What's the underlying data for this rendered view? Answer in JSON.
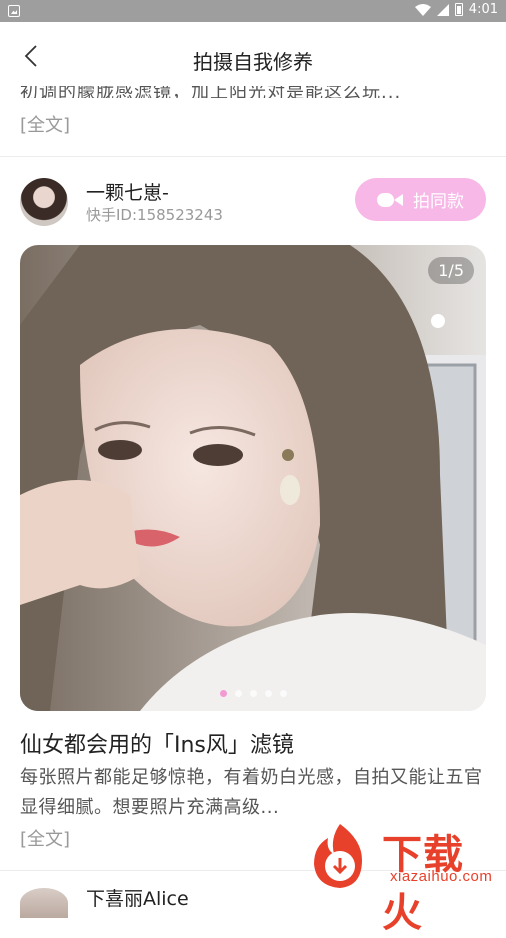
{
  "status_bar": {
    "time": "4:01"
  },
  "header": {
    "title": "拍摄自我修养",
    "back_icon": "chevron-left-icon"
  },
  "previous_post": {
    "desc_tail": "初调的朦胧感滤镜，加上阳光对是能这么玩...",
    "full_text_label": "[全文]"
  },
  "post": {
    "author": {
      "name": "一颗七崽-",
      "id_label": "快手ID:158523243"
    },
    "shoot_same_button": {
      "label": "拍同款",
      "icon": "video-camera-icon"
    },
    "image": {
      "counter": "1/5",
      "dots_total": 5,
      "active_dot": 0
    },
    "title": "仙女都会用的「Ins风」滤镜",
    "description": "每张照片都能足够惊艳，有着奶白光感，自拍又能让五官显得细腻。想要照片充满高级...",
    "full_text_label": "[全文]"
  },
  "next_post": {
    "author_name": "下喜丽Alice"
  },
  "watermark": {
    "text": "下载火",
    "url": "xiazaihuo.com"
  },
  "colors": {
    "accent_pink": "#f7b7e7",
    "watermark_red": "#e8412b"
  }
}
